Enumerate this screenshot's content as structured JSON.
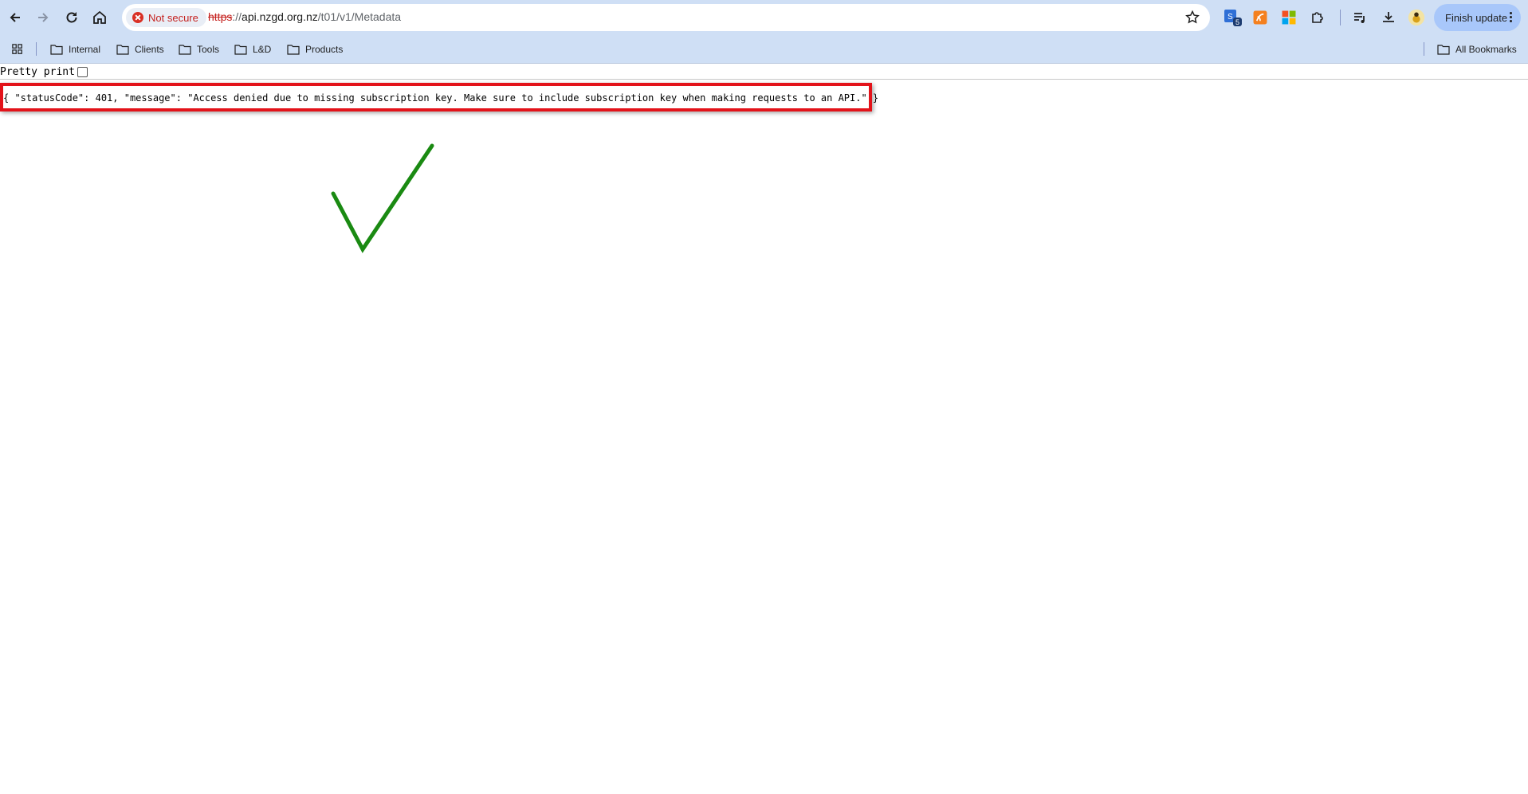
{
  "address_bar": {
    "security_chip": "Not secure",
    "url_scheme": "https",
    "url_sep": "://",
    "url_host": "api.nzgd.org.nz",
    "url_path": "/t01/v1/Metadata"
  },
  "toolbar": {
    "finish_update_label": "Finish update",
    "extension_badge": "5"
  },
  "bookmarks": {
    "items": [
      {
        "label": "Internal"
      },
      {
        "label": "Clients"
      },
      {
        "label": "Tools"
      },
      {
        "label": "L&D"
      },
      {
        "label": "Products"
      }
    ],
    "all_bookmarks_label": "All Bookmarks"
  },
  "page": {
    "pretty_print_label": "Pretty print",
    "pretty_print_checked": false,
    "json_text": "{ \"statusCode\": 401, \"message\": \"Access denied due to missing subscription key. Make sure to include subscription key when making requests to an API.\" }"
  },
  "annotation": {
    "highlight_color": "#e3131a",
    "check_color": "#1a8a12"
  }
}
